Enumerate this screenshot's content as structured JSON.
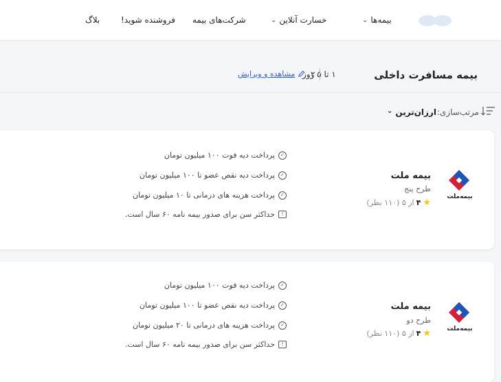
{
  "header": {
    "nav": [
      {
        "label": "بیمه‌ها",
        "has_dropdown": true
      },
      {
        "label": "خسارت آنلاین",
        "has_dropdown": true
      },
      {
        "label": "شرکت‌های بیمه",
        "has_dropdown": false
      },
      {
        "label": "فروشنده شوید!",
        "has_dropdown": false
      },
      {
        "label": "بلاگ",
        "has_dropdown": false
      }
    ]
  },
  "page": {
    "title": "بیمه مسافرت داخلی",
    "duration": "۱ تا ۵ روز",
    "travelers": "۲",
    "edit_label": "مشاهده و ویرایش"
  },
  "sort": {
    "label": "مرتب‌سازی:",
    "value": "ارزان‌ترین"
  },
  "colors": {
    "accent": "#2d5bd6",
    "brand_red": "#d21f3c",
    "brand_blue": "#1d56b8",
    "star": "#f5c518"
  },
  "results": [
    {
      "company": "بیمه ملت",
      "brand_text": "بیمه‌ملت",
      "plan": "طرح پنج",
      "rating_score": "۴",
      "rating_text": "از ۵ (۱۱۰ نظر)",
      "features": [
        "پرداخت دیه فوت ۱۰۰ میلیون تومان",
        "پرداخت دیه نقص عضو تا ۱۰۰ میلیون تومان",
        "پرداخت هزینه های درمانی تا ۱۰ میلیون تومان"
      ],
      "note": "حداکثر سن برای صدور بیمه نامه ۶۰ سال است."
    },
    {
      "company": "بیمه ملت",
      "brand_text": "بیمه‌ملت",
      "plan": "طرح دو",
      "rating_score": "۴",
      "rating_text": "از ۵ (۱۱۰ نظر)",
      "features": [
        "پرداخت دیه فوت ۱۰۰ میلیون تومان",
        "پرداخت دیه نقص عضو تا ۱۰۰ میلیون تومان",
        "پرداخت هزینه های درمانی تا ۲۰ میلیون تومان"
      ],
      "note": "حداکثر سن برای صدور بیمه نامه ۶۰ سال است."
    }
  ]
}
